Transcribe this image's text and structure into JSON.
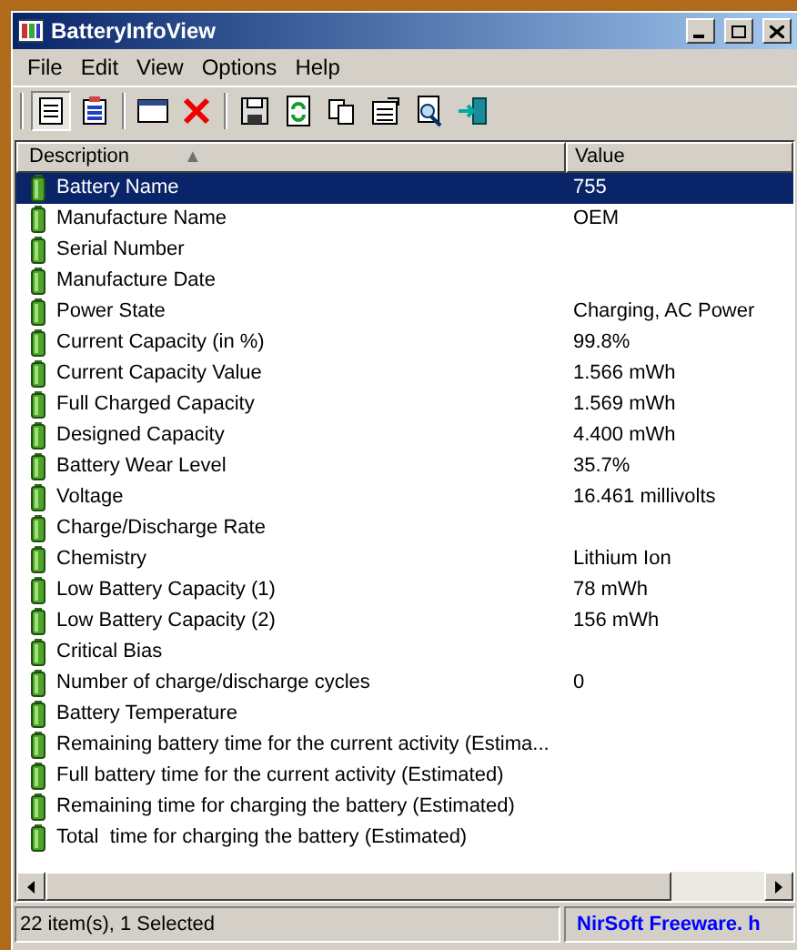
{
  "window": {
    "title": "BatteryInfoView"
  },
  "menu": [
    "File",
    "Edit",
    "View",
    "Options",
    "Help"
  ],
  "table": {
    "columns": [
      {
        "label": "Description",
        "sort": "▲"
      },
      {
        "label": "Value"
      }
    ],
    "rows": [
      {
        "description": "Battery Name",
        "value": "755",
        "selected": true
      },
      {
        "description": "Manufacture Name",
        "value": "OEM",
        "selected": false
      },
      {
        "description": "Serial Number",
        "selected": false
      },
      {
        "description": "Manufacture Date",
        "selected": false
      },
      {
        "description": "Power State",
        "value": "Charging, AC Power",
        "selected": false
      },
      {
        "description": "Current Capacity (in %)",
        "value": "99.8%",
        "selected": false
      },
      {
        "description": "Current Capacity Value",
        "value": "1.566 mWh",
        "selected": false
      },
      {
        "description": "Full Charged Capacity",
        "value": "1.569 mWh",
        "selected": false
      },
      {
        "description": "Designed Capacity",
        "value": "4.400 mWh",
        "selected": false
      },
      {
        "description": "Battery Wear Level",
        "value": "35.7%",
        "selected": false
      },
      {
        "description": "Voltage",
        "value": "16.461 millivolts",
        "selected": false
      },
      {
        "description": "Charge/Discharge Rate",
        "selected": false
      },
      {
        "description": "Chemistry",
        "value": "Lithium Ion",
        "selected": false
      },
      {
        "description": "Low Battery Capacity (1)",
        "value": "78 mWh",
        "selected": false
      },
      {
        "description": "Low Battery Capacity (2)",
        "value": "156 mWh",
        "selected": false
      },
      {
        "description": "Critical Bias",
        "selected": false
      },
      {
        "description": "Number of charge/discharge cycles",
        "value": "0",
        "selected": false
      },
      {
        "description": "Battery Temperature",
        "selected": false
      },
      {
        "description": "Remaining battery time for the current activity (Estima...",
        "selected": false
      },
      {
        "description": "Full battery time for the current activity (Estimated)",
        "selected": false
      },
      {
        "description": "Remaining time for charging the battery (Estimated)",
        "selected": false
      },
      {
        "description": "Total  time for charging the battery (Estimated)",
        "selected": false
      }
    ]
  },
  "status_bar": {
    "count": "22 item(s), 1 Selected",
    "link": "NirSoft Freeware.  h"
  }
}
